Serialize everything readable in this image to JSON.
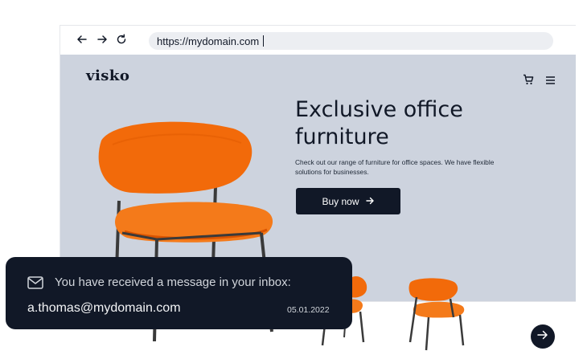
{
  "browser": {
    "url": "https://mydomain.com",
    "icons": [
      "back-arrow-icon",
      "forward-arrow-icon",
      "reload-icon"
    ]
  },
  "site": {
    "logo": "visko",
    "header_icons": [
      "cart-icon",
      "menu-icon"
    ],
    "hero": {
      "title": "Exclusive office furniture",
      "subtitle": "Check out our range of furniture for office spaces. We have flexible solutions for businesses.",
      "cta_label": "Buy now"
    }
  },
  "notification": {
    "message": "You have received a message in your inbox:",
    "email": "a.thomas@mydomain.com",
    "date": "05.01.2022"
  },
  "colors": {
    "hero_bg": "#cdd3de",
    "dark": "#111827",
    "chair_orange": "#f26a0a",
    "url_bar": "#eceef2"
  }
}
